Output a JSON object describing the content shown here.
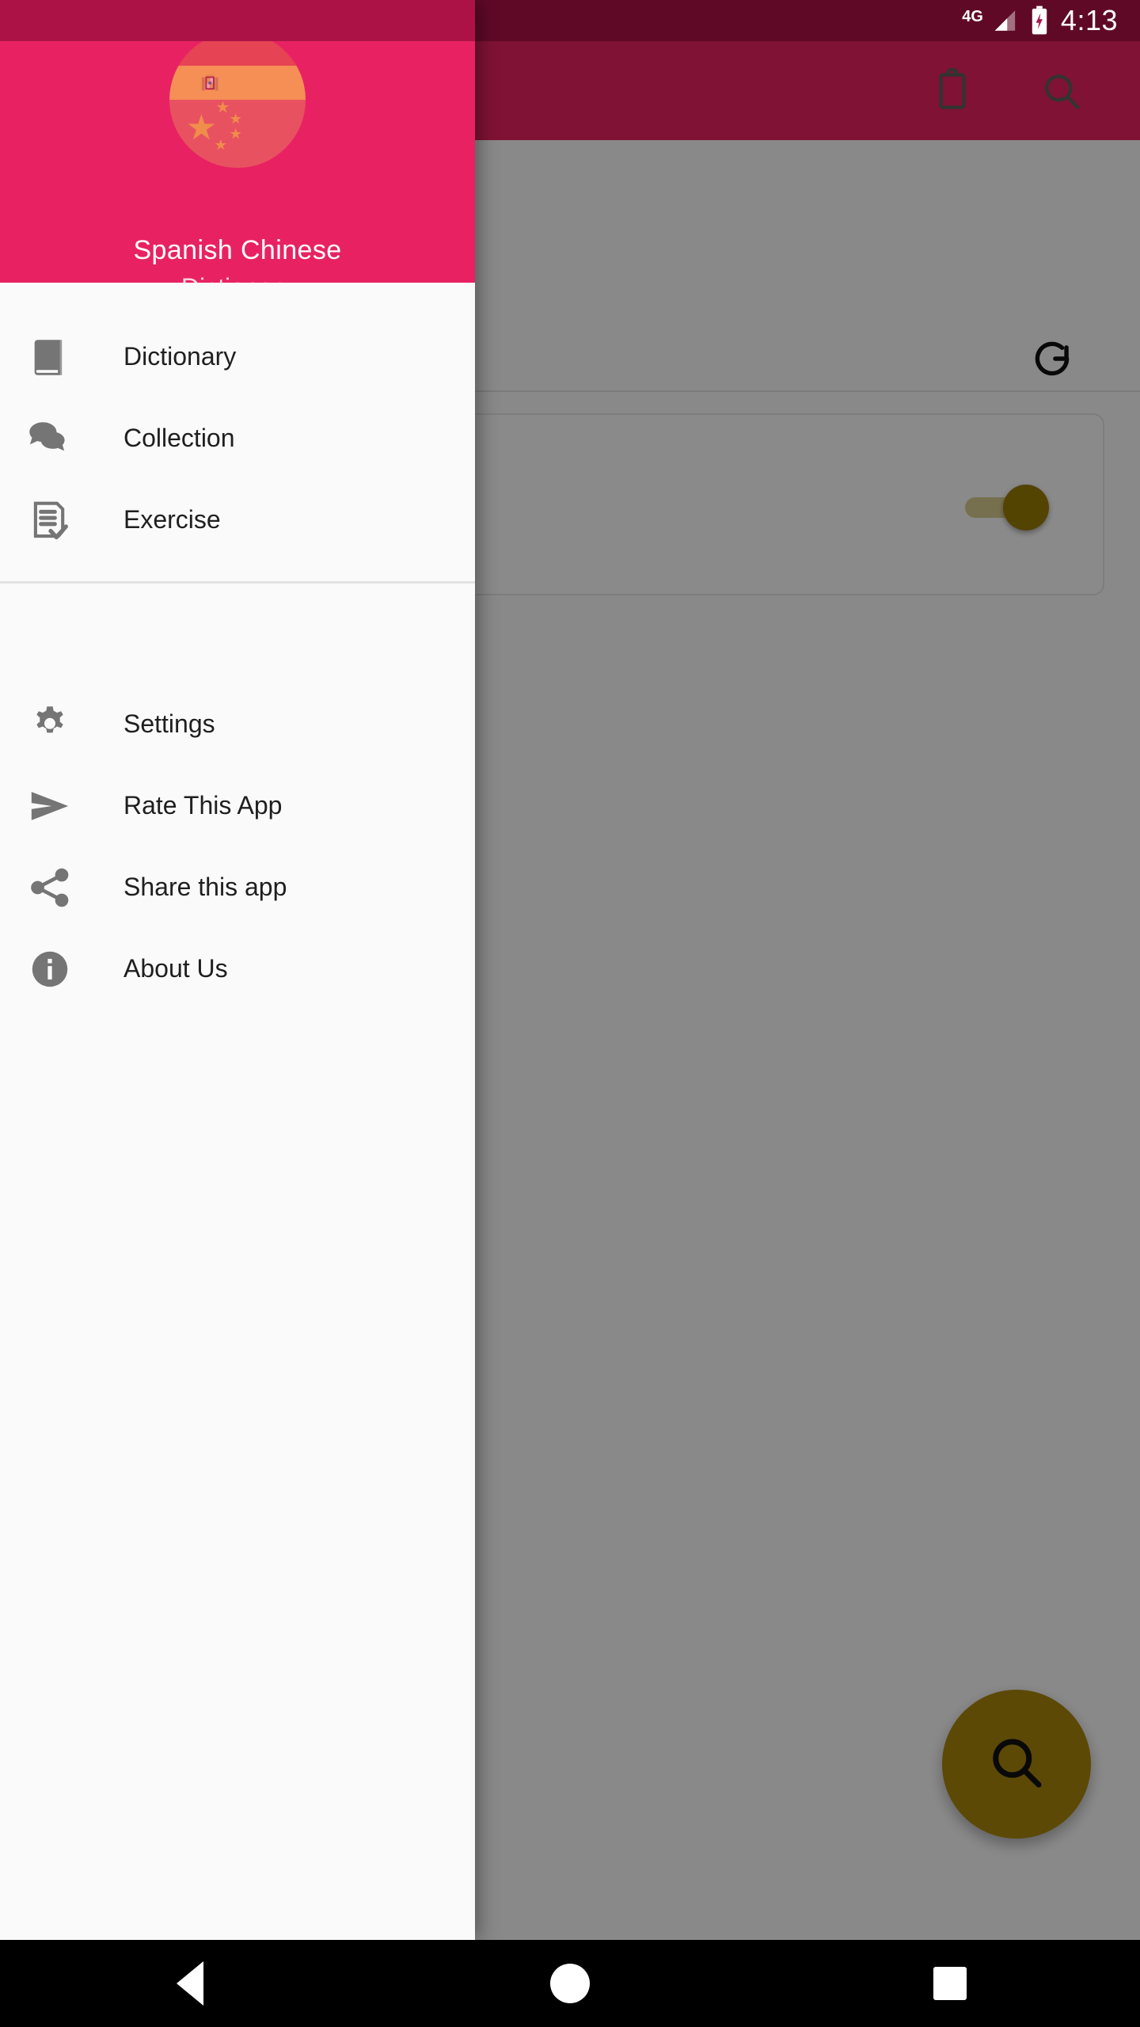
{
  "statusbar": {
    "network_label": "4G",
    "time": "4:13",
    "signal_icon": "signal-bars-icon",
    "battery_icon": "battery-charging-icon",
    "background_color": "#AD1247"
  },
  "drawer": {
    "header": {
      "title": "Spanish  Chinese",
      "subtitle": "Dictionary",
      "logo_icon": "spanish-chinese-flag-logo",
      "background_color": "#E82262"
    },
    "groups": [
      {
        "items": [
          {
            "label": "Dictionary",
            "icon": "book-icon"
          },
          {
            "label": "Collection",
            "icon": "chat-bubbles-icon"
          },
          {
            "label": "Exercise",
            "icon": "document-check-icon"
          }
        ]
      },
      {
        "items": [
          {
            "label": "Settings",
            "icon": "gear-icon"
          },
          {
            "label": "Rate This App",
            "icon": "send-arrow-icon"
          },
          {
            "label": "Share this app",
            "icon": "share-nodes-icon"
          },
          {
            "label": "About Us",
            "icon": "info-circle-icon"
          }
        ]
      }
    ]
  },
  "background_app": {
    "appbar": {
      "clipboard_icon": "clipboard-icon",
      "search_icon": "search-icon",
      "background_color": "#E82262"
    },
    "refresh_icon": "refresh-icon",
    "card": {
      "toggle_icon": "toggle-switch-on",
      "toggle_state": "on",
      "toggle_color": "#9A7D04"
    },
    "fab": {
      "icon": "search-icon",
      "color": "#A8860B"
    }
  },
  "navbar": {
    "back_label": "back-button",
    "home_label": "home-button",
    "recents_label": "recents-button",
    "background_color": "#000000"
  }
}
